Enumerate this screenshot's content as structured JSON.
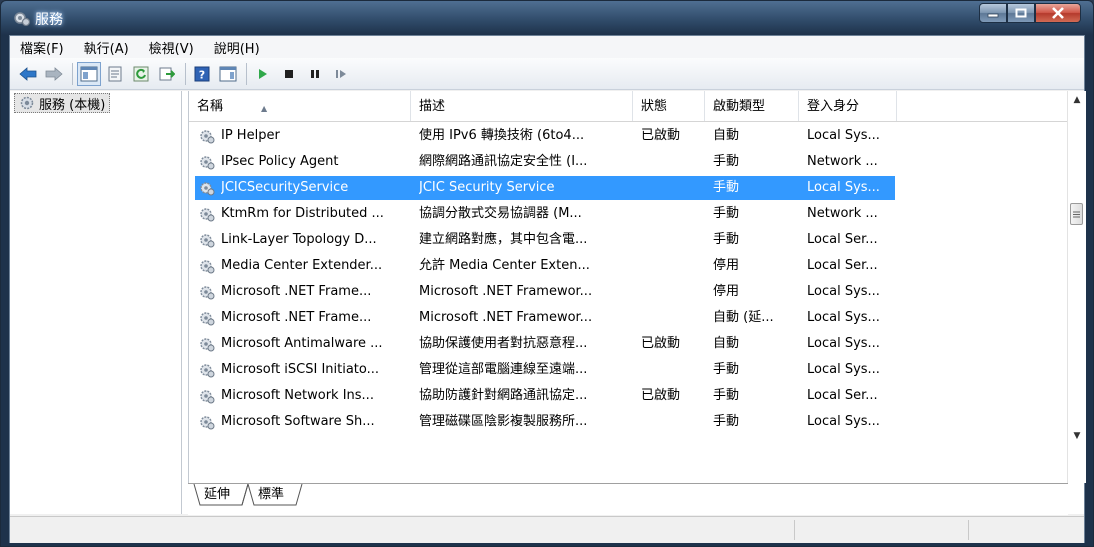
{
  "window": {
    "title": "服務",
    "icon": "services-gear-icon"
  },
  "menu": [
    {
      "label": "檔案(F)"
    },
    {
      "label": "執行(A)"
    },
    {
      "label": "檢視(V)"
    },
    {
      "label": "說明(H)"
    }
  ],
  "toolbar": {
    "icons": [
      "back-arrow-icon",
      "forward-arrow-icon",
      "show-hide-console-tree-icon",
      "properties-icon",
      "refresh-icon",
      "export-list-icon",
      "help-icon",
      "show-hide-action-pane-icon",
      "start-service-icon",
      "stop-service-icon",
      "pause-service-icon",
      "resume-service-icon"
    ]
  },
  "tree": {
    "root_label": "服務 (本機)"
  },
  "columns": [
    {
      "label": "名稱"
    },
    {
      "label": "描述"
    },
    {
      "label": "狀態"
    },
    {
      "label": "啟動類型"
    },
    {
      "label": "登入身分"
    }
  ],
  "rows": [
    {
      "name": "IP Helper",
      "desc": "使用 IPv6 轉換技術 (6to4...",
      "status": "已啟動",
      "startup": "自動",
      "logon": "Local Sys..."
    },
    {
      "name": "IPsec Policy Agent",
      "desc": "網際網路通訊協定安全性 (I...",
      "status": "",
      "startup": "手動",
      "logon": "Network ..."
    },
    {
      "name": "JCICSecurityService",
      "desc": "JCIC Security Service",
      "status": "",
      "startup": "手動",
      "logon": "Local Sys...",
      "selected": true
    },
    {
      "name": "KtmRm for Distributed ...",
      "desc": "協調分散式交易協調器 (M...",
      "status": "",
      "startup": "手動",
      "logon": "Network ..."
    },
    {
      "name": "Link-Layer Topology D...",
      "desc": "建立網路對應，其中包含電...",
      "status": "",
      "startup": "手動",
      "logon": "Local Ser..."
    },
    {
      "name": "Media Center Extender...",
      "desc": "允許 Media Center Exten...",
      "status": "",
      "startup": "停用",
      "logon": "Local Ser..."
    },
    {
      "name": "Microsoft .NET Frame...",
      "desc": "Microsoft .NET Framewor...",
      "status": "",
      "startup": "停用",
      "logon": "Local Sys..."
    },
    {
      "name": "Microsoft .NET Frame...",
      "desc": "Microsoft .NET Framewor...",
      "status": "",
      "startup": "自動 (延...",
      "logon": "Local Sys..."
    },
    {
      "name": "Microsoft Antimalware ...",
      "desc": "協助保護使用者對抗惡意程...",
      "status": "已啟動",
      "startup": "自動",
      "logon": "Local Sys..."
    },
    {
      "name": "Microsoft iSCSI Initiato...",
      "desc": "管理從這部電腦連線至遠端...",
      "status": "",
      "startup": "手動",
      "logon": "Local Sys..."
    },
    {
      "name": "Microsoft Network Ins...",
      "desc": "協助防護針對網路通訊協定...",
      "status": "已啟動",
      "startup": "手動",
      "logon": "Local Ser..."
    },
    {
      "name": "Microsoft Software Sh...",
      "desc": "管理磁碟區陰影複製服務所...",
      "status": "",
      "startup": "手動",
      "logon": "Local Sys..."
    }
  ],
  "tabs": [
    {
      "label": "延伸"
    },
    {
      "label": "標準",
      "active": true
    }
  ],
  "colors": {
    "selection": "#3399ff",
    "titlebar": "#2f4a68"
  }
}
